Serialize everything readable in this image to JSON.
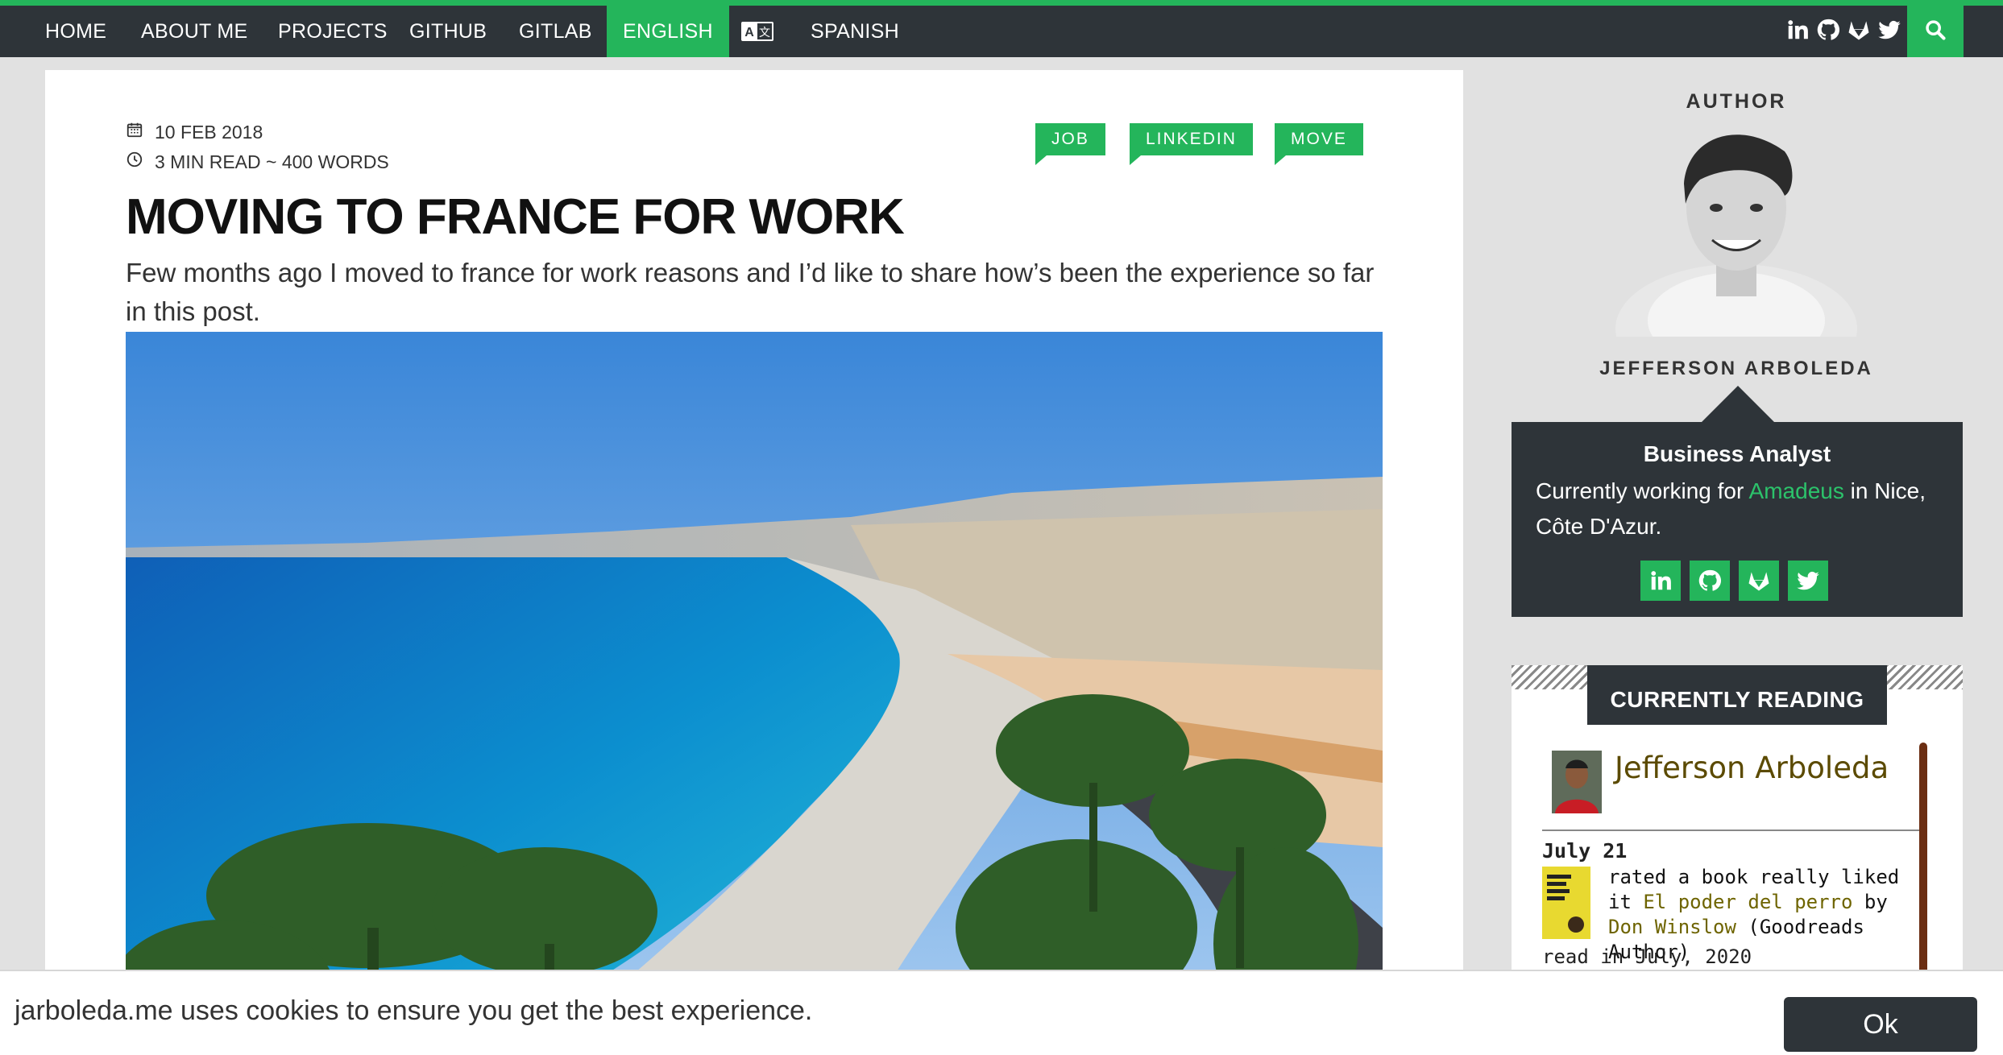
{
  "nav": {
    "items": [
      "HOME",
      "ABOUT ME",
      "PROJECTS",
      "GITHUB",
      "GITLAB"
    ],
    "active_language": "ENGLISH",
    "translate_icon": "translate-icon",
    "other_language": "SPANISH",
    "social_icons": [
      "linkedin-icon",
      "github-icon",
      "gitlab-icon",
      "twitter-icon"
    ],
    "search_icon": "search-icon",
    "accent_color": "#24b55b",
    "bar_color": "#2e3439"
  },
  "post": {
    "date": "10 FEB 2018",
    "read_time": "3 MIN READ ~ 400 WORDS",
    "tags": [
      "JOB",
      "LINKEDIN",
      "MOVE"
    ],
    "title": "MOVING TO FRANCE FOR WORK",
    "excerpt": "Few months ago I moved to france for work reasons and I’d like to share how’s been the experience so far in this post."
  },
  "sidebar": {
    "author_label": "AUTHOR",
    "author_name": "JEFFERSON ARBOLEDA",
    "role": "Business Analyst",
    "bio_prefix": "Currently working for",
    "bio_company": "Amadeus",
    "bio_suffix": "in Nice, Côte D'Azur.",
    "social_icons": [
      "linkedin-icon",
      "github-icon",
      "gitlab-icon",
      "twitter-icon"
    ],
    "reading": {
      "title": "CURRENTLY READING",
      "user": "Jefferson Arboleda",
      "date": "July 21",
      "action": "rated a book really liked it",
      "book": "El poder del perro",
      "by": "by",
      "author": "Don Winslow",
      "author_note": "(Goodreads Author)",
      "read_when": "read in July, 2020"
    }
  },
  "cookie": {
    "text": "jarboleda.me uses cookies to ensure you get the best experience.",
    "button": "Ok"
  }
}
